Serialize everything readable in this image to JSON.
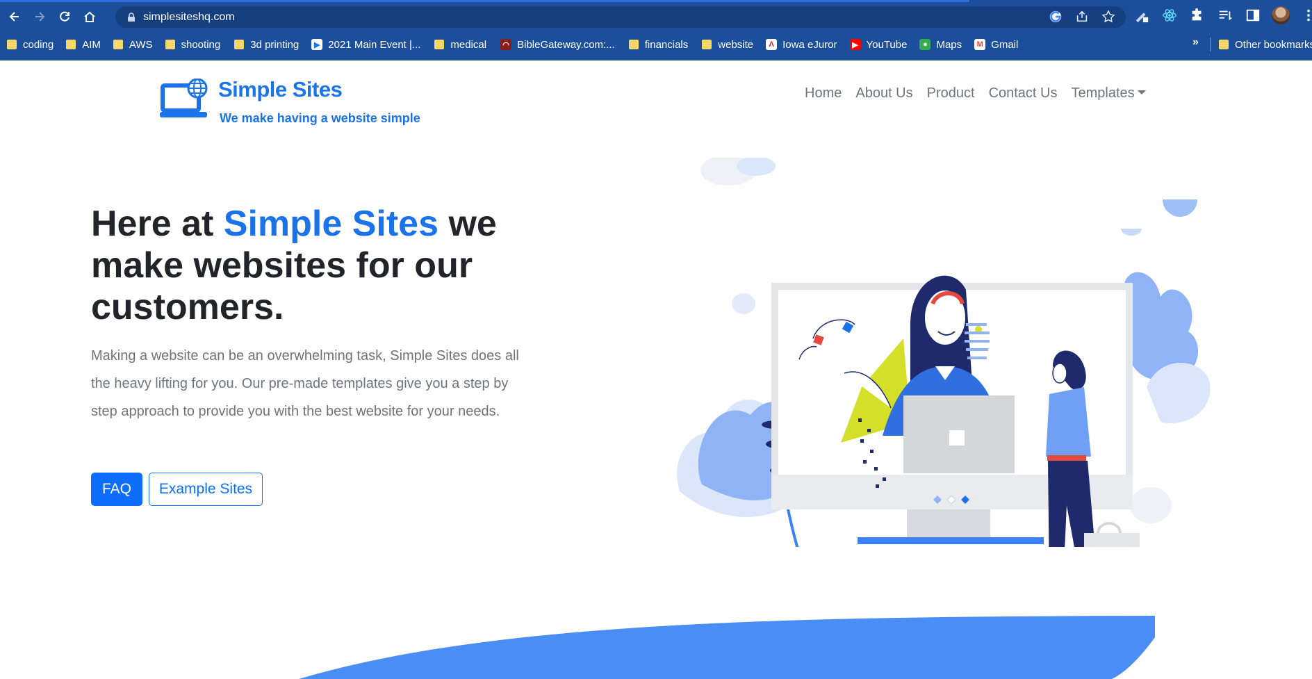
{
  "browser": {
    "url": "simplesiteshq.com",
    "bookmarks": [
      {
        "label": "coding",
        "type": "folder"
      },
      {
        "label": "AIM",
        "type": "folder"
      },
      {
        "label": "AWS",
        "type": "folder"
      },
      {
        "label": "shooting",
        "type": "folder"
      },
      {
        "label": "3d printing",
        "type": "folder"
      },
      {
        "label": "2021 Main Event |...",
        "type": "site"
      },
      {
        "label": "medical",
        "type": "folder"
      },
      {
        "label": "BibleGateway.com:...",
        "type": "site"
      },
      {
        "label": "financials",
        "type": "folder"
      },
      {
        "label": "website",
        "type": "folder"
      },
      {
        "label": "Iowa eJuror",
        "type": "site"
      },
      {
        "label": "YouTube",
        "type": "site"
      },
      {
        "label": "Maps",
        "type": "site"
      },
      {
        "label": "Gmail",
        "type": "site"
      }
    ],
    "bookmarks_more": "»",
    "other_bookmarks": "Other bookmarks"
  },
  "site": {
    "brand": "Simple Sites",
    "tagline": "We make having a website simple",
    "nav": {
      "home": "Home",
      "about": "About Us",
      "product": "Product",
      "contact": "Contact Us",
      "templates": "Templates"
    },
    "hero": {
      "title_before": "Here at ",
      "title_accent": "Simple Sites",
      "title_after": " we make websites for our customers.",
      "body": "Making a website can be an overwhelming task, Simple Sites does all the heavy lifting for you. Our pre-made templates give you a step by step approach to provide you with the best website for your needs.",
      "faq_button": "FAQ",
      "examples_button": "Example Sites"
    }
  },
  "colors": {
    "chrome": "#1b4f9b",
    "brand_blue": "#1a73e8",
    "button_blue": "#0d6efd",
    "wave_blue": "#4a8ef5"
  }
}
